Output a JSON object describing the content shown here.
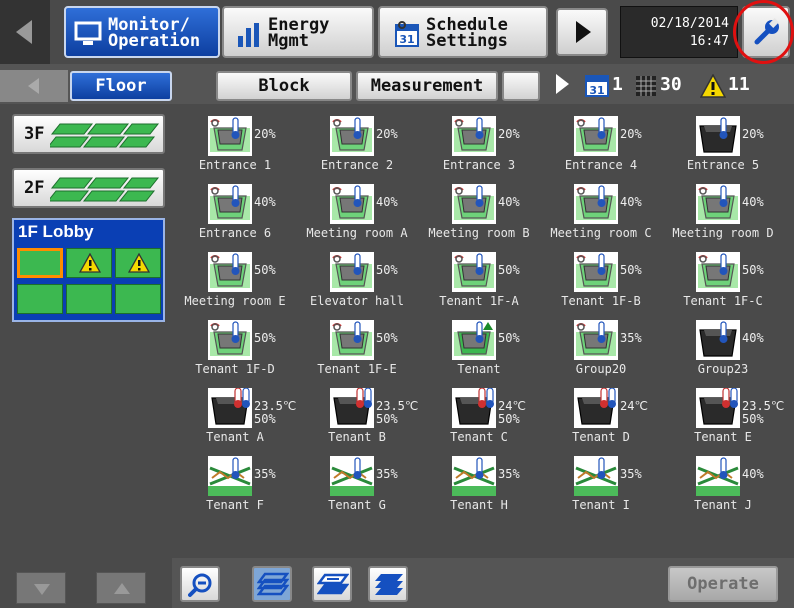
{
  "topbar": {
    "tabs": [
      {
        "label": "Monitor/\nOperation",
        "icon": "monitor-icon",
        "active": true
      },
      {
        "label": "Energy\nMgmt",
        "icon": "bar-chart-icon",
        "active": false
      },
      {
        "label": "Schedule\nSettings",
        "icon": "calendar-icon",
        "active": false
      }
    ],
    "date": "02/18/2014",
    "time": "16:47",
    "maintenance_icon": "wrench-icon"
  },
  "subbar": {
    "tabs": [
      {
        "label": "Floor",
        "active": true
      },
      {
        "label": "Block",
        "active": false
      },
      {
        "label": "Measurement",
        "active": false
      }
    ],
    "counts": {
      "schedule": "1",
      "grid": "30",
      "warning": "11"
    }
  },
  "sidebar": {
    "floors": [
      "3F",
      "2F"
    ],
    "lobby": {
      "label": "1F Lobby"
    }
  },
  "units": [
    {
      "name": "Entrance 1",
      "value": "20%",
      "type": "vent"
    },
    {
      "name": "Entrance 2",
      "value": "20%",
      "type": "vent"
    },
    {
      "name": "Entrance 3",
      "value": "20%",
      "type": "vent"
    },
    {
      "name": "Entrance 4",
      "value": "20%",
      "type": "vent"
    },
    {
      "name": "Entrance 5",
      "value": "20%",
      "type": "ac-dark"
    },
    {
      "name": "Entrance 6",
      "value": "40%",
      "type": "vent"
    },
    {
      "name": "Meeting room A",
      "value": "40%",
      "type": "vent"
    },
    {
      "name": "Meeting room B",
      "value": "40%",
      "type": "vent"
    },
    {
      "name": "Meeting room C",
      "value": "40%",
      "type": "vent"
    },
    {
      "name": "Meeting room D",
      "value": "40%",
      "type": "vent"
    },
    {
      "name": "Meeting room E",
      "value": "50%",
      "type": "vent"
    },
    {
      "name": "Elevator hall",
      "value": "50%",
      "type": "vent"
    },
    {
      "name": "Tenant 1F-A",
      "value": "50%",
      "type": "vent"
    },
    {
      "name": "Tenant 1F-B",
      "value": "50%",
      "type": "vent"
    },
    {
      "name": "Tenant 1F-C",
      "value": "50%",
      "type": "vent"
    },
    {
      "name": "Tenant 1F-D",
      "value": "50%",
      "type": "vent"
    },
    {
      "name": "Tenant 1F-E",
      "value": "50%",
      "type": "vent"
    },
    {
      "name": "Tenant",
      "value": "50%",
      "type": "vent-green"
    },
    {
      "name": "Group20",
      "value": "35%",
      "type": "vent"
    },
    {
      "name": "Group23",
      "value": "40%",
      "type": "ac-dark"
    },
    {
      "name": "Tenant A",
      "value": "23.5℃\n50%",
      "type": "ac-dark-thermo"
    },
    {
      "name": "Tenant B",
      "value": "23.5℃\n50%",
      "type": "ac-dark-thermo"
    },
    {
      "name": "Tenant C",
      "value": "24℃\n50%",
      "type": "ac-dark-thermo"
    },
    {
      "name": "Tenant D",
      "value": "24℃",
      "type": "ac-dark-thermo"
    },
    {
      "name": "Tenant E",
      "value": "23.5℃\n50%",
      "type": "ac-dark-thermo"
    },
    {
      "name": "Tenant F",
      "value": "35%",
      "type": "heat-exch"
    },
    {
      "name": "Tenant G",
      "value": "35%",
      "type": "heat-exch"
    },
    {
      "name": "Tenant H",
      "value": "35%",
      "type": "heat-exch"
    },
    {
      "name": "Tenant I",
      "value": "35%",
      "type": "heat-exch"
    },
    {
      "name": "Tenant J",
      "value": "40%",
      "type": "heat-exch"
    }
  ],
  "bottombar": {
    "operate_label": "Operate",
    "icons": [
      "zoom-out-icon",
      "layout-1-icon",
      "layout-2-icon",
      "layout-3-icon"
    ]
  },
  "colors": {
    "accent_blue": "#1550c0",
    "status_green": "#3cb850",
    "warning_yellow": "#f5d800",
    "highlight_red": "#e01010"
  }
}
